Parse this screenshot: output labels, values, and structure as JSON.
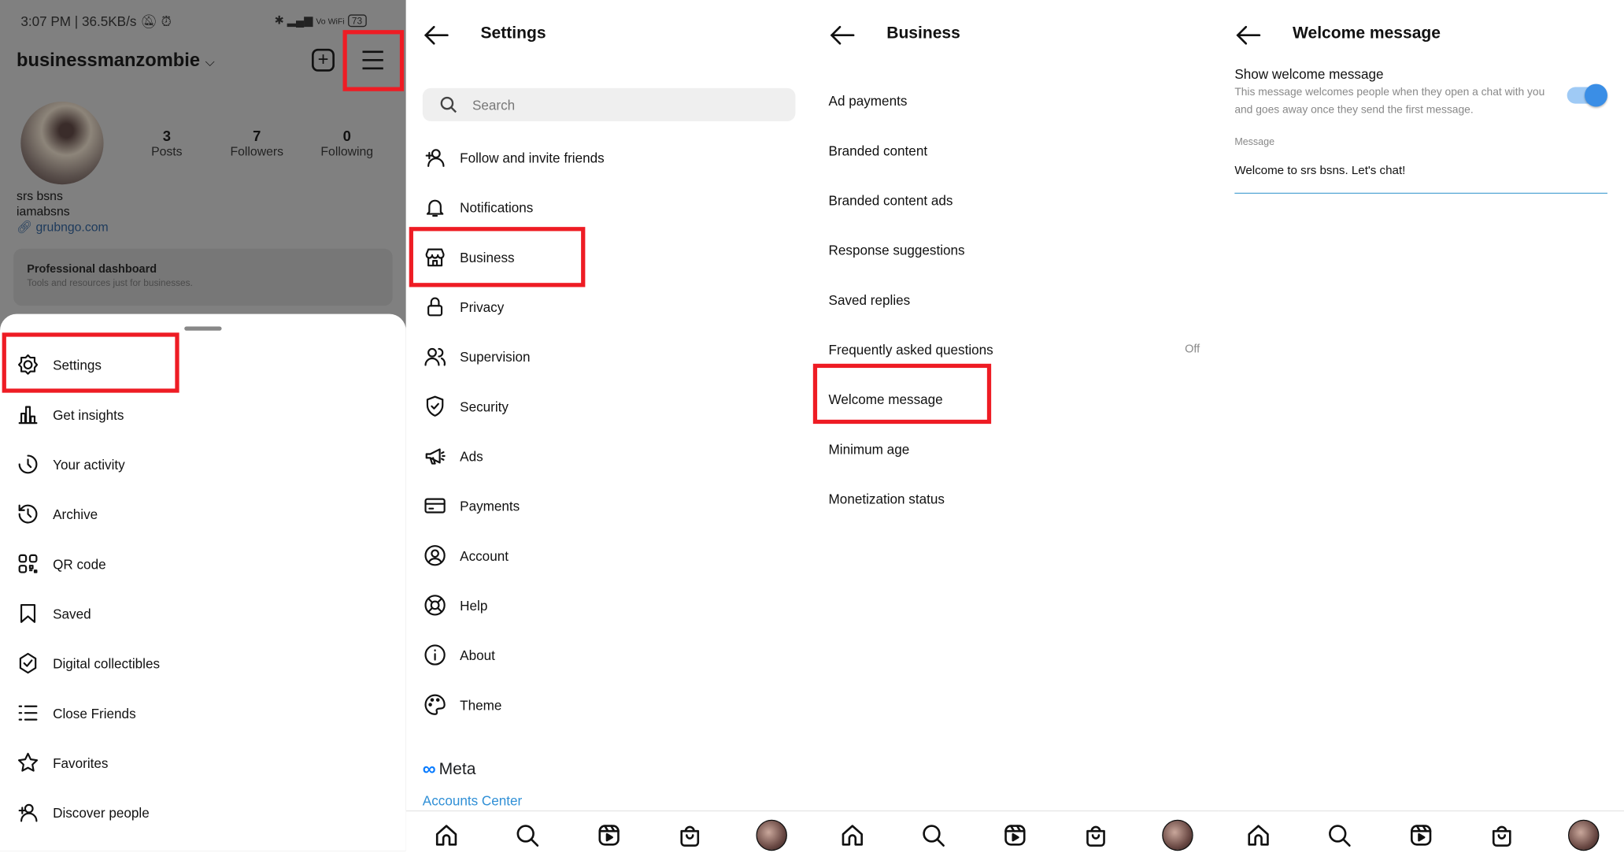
{
  "panel1": {
    "status": {
      "time_speed": "3:07 PM | 36.5KB/s",
      "battery": "73",
      "network": "Vo WiFi"
    },
    "username": "businessmanzombie",
    "stats": [
      {
        "value": "3",
        "label": "Posts"
      },
      {
        "value": "7",
        "label": "Followers"
      },
      {
        "value": "0",
        "label": "Following"
      }
    ],
    "name": "srs bsns",
    "bio": "iamabsns",
    "link": "grubngo.com",
    "dashboard": {
      "title": "Professional dashboard",
      "subtitle": "Tools and resources just for businesses."
    },
    "menu": [
      {
        "label": "Settings",
        "icon": "settings"
      },
      {
        "label": "Get insights",
        "icon": "insights"
      },
      {
        "label": "Your activity",
        "icon": "activity"
      },
      {
        "label": "Archive",
        "icon": "archive"
      },
      {
        "label": "QR code",
        "icon": "qr"
      },
      {
        "label": "Saved",
        "icon": "bookmark"
      },
      {
        "label": "Digital collectibles",
        "icon": "collectibles"
      },
      {
        "label": "Close Friends",
        "icon": "list"
      },
      {
        "label": "Favorites",
        "icon": "star"
      },
      {
        "label": "Discover people",
        "icon": "add-person"
      }
    ]
  },
  "panel2": {
    "title": "Settings",
    "search_placeholder": "Search",
    "items": [
      {
        "label": "Follow and invite friends",
        "icon": "add-person"
      },
      {
        "label": "Notifications",
        "icon": "bell"
      },
      {
        "label": "Business",
        "icon": "shop"
      },
      {
        "label": "Privacy",
        "icon": "lock"
      },
      {
        "label": "Supervision",
        "icon": "people"
      },
      {
        "label": "Security",
        "icon": "shield"
      },
      {
        "label": "Ads",
        "icon": "megaphone"
      },
      {
        "label": "Payments",
        "icon": "card"
      },
      {
        "label": "Account",
        "icon": "account"
      },
      {
        "label": "Help",
        "icon": "help"
      },
      {
        "label": "About",
        "icon": "info"
      },
      {
        "label": "Theme",
        "icon": "palette"
      }
    ],
    "meta_logo": "Meta",
    "accounts_center": "Accounts Center"
  },
  "panel3": {
    "title": "Business",
    "items": [
      {
        "label": "Ad payments"
      },
      {
        "label": "Branded content"
      },
      {
        "label": "Branded content ads"
      },
      {
        "label": "Response suggestions"
      },
      {
        "label": "Saved replies"
      },
      {
        "label": "Frequently asked questions",
        "value": "Off"
      },
      {
        "label": "Welcome message"
      },
      {
        "label": "Minimum age"
      },
      {
        "label": "Monetization status"
      }
    ]
  },
  "panel4": {
    "title": "Welcome message",
    "toggle_label": "Show welcome message",
    "toggle_desc": "This message welcomes people when they open a chat with you and goes away once they send the first message.",
    "toggle_on": true,
    "field_label": "Message",
    "field_value": "Welcome to srs bsns. Let's chat!"
  },
  "bottom_nav": [
    "home",
    "search",
    "reels",
    "shop",
    "profile"
  ],
  "colors": {
    "highlight": "#ee1c24",
    "accent": "#3897f0",
    "link": "#2f8fd6"
  }
}
